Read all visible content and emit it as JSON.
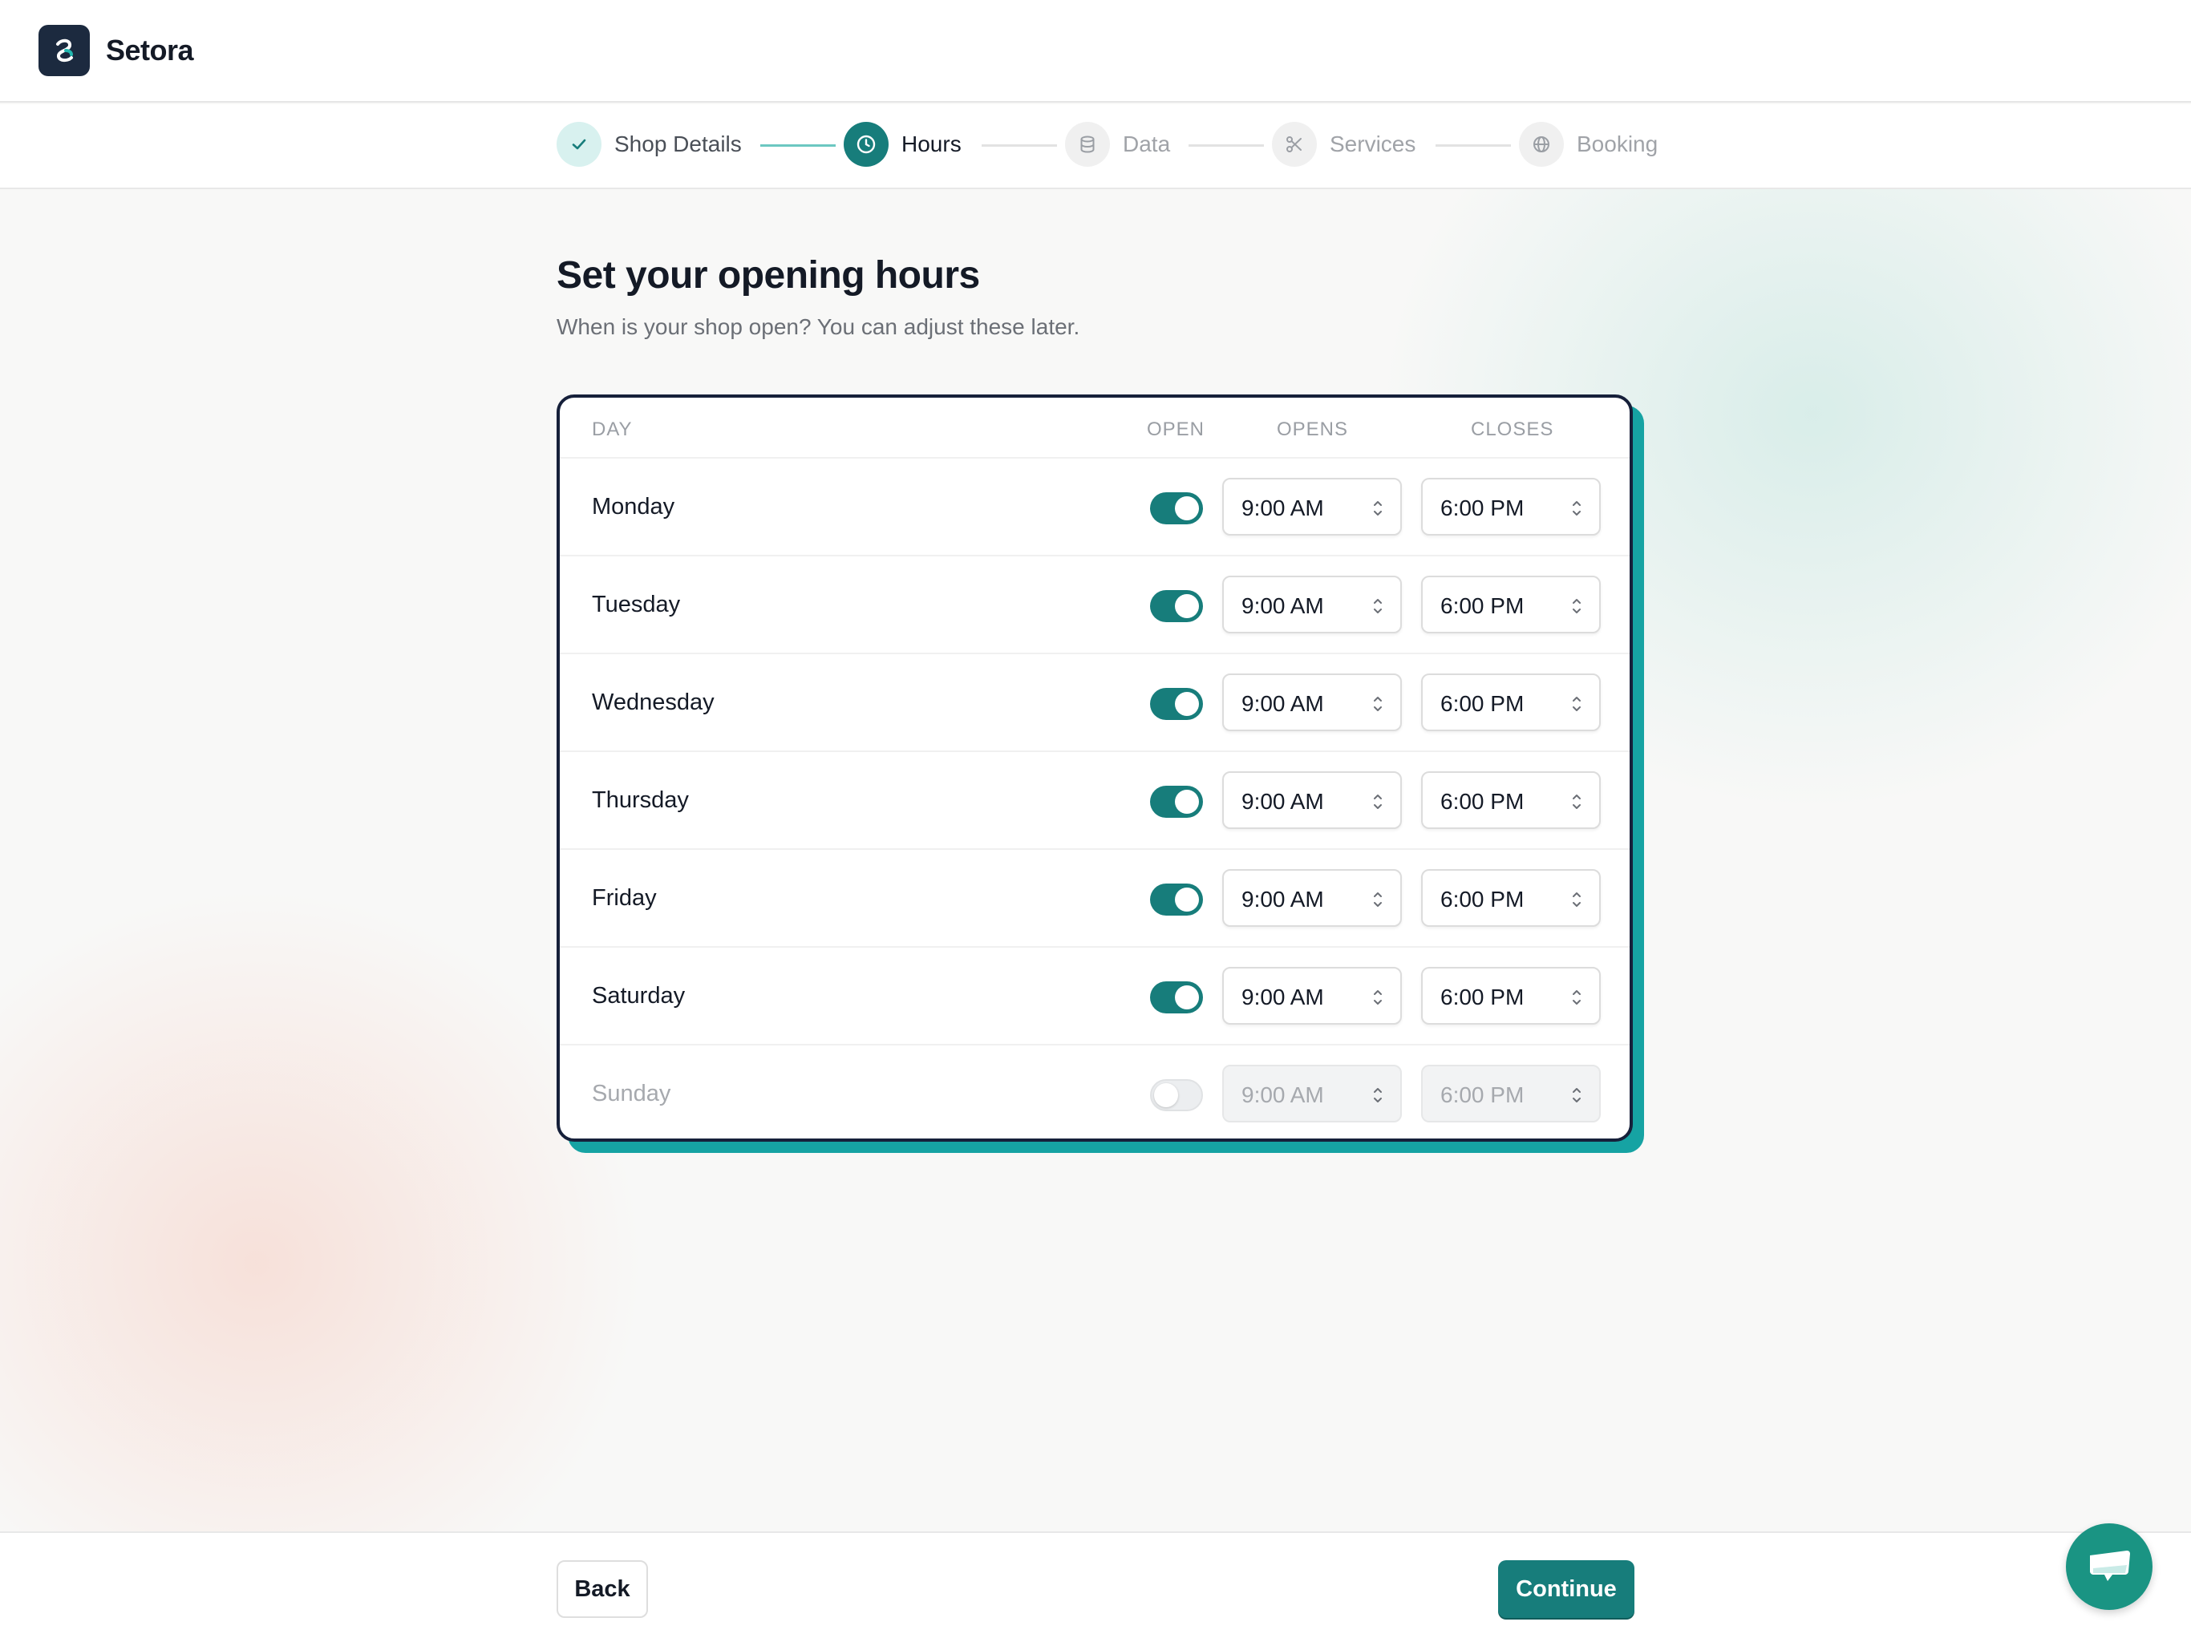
{
  "app": {
    "name": "Setora"
  },
  "stepper": {
    "steps": [
      {
        "label": "Shop Details",
        "state": "done",
        "icon": "check-icon"
      },
      {
        "label": "Hours",
        "state": "active",
        "icon": "clock-icon"
      },
      {
        "label": "Data",
        "state": "pending",
        "icon": "database-icon"
      },
      {
        "label": "Services",
        "state": "pending",
        "icon": "scissors-icon"
      },
      {
        "label": "Booking",
        "state": "pending",
        "icon": "globe-icon"
      }
    ]
  },
  "page": {
    "title": "Set your opening hours",
    "subtitle": "When is your shop open? You can adjust these later."
  },
  "table": {
    "headers": {
      "day": "DAY",
      "open": "OPEN",
      "opens": "OPENS",
      "closes": "CLOSES"
    },
    "rows": [
      {
        "day": "Monday",
        "open": true,
        "opens": "9:00 AM",
        "closes": "6:00 PM"
      },
      {
        "day": "Tuesday",
        "open": true,
        "opens": "9:00 AM",
        "closes": "6:00 PM"
      },
      {
        "day": "Wednesday",
        "open": true,
        "opens": "9:00 AM",
        "closes": "6:00 PM"
      },
      {
        "day": "Thursday",
        "open": true,
        "opens": "9:00 AM",
        "closes": "6:00 PM"
      },
      {
        "day": "Friday",
        "open": true,
        "opens": "9:00 AM",
        "closes": "6:00 PM"
      },
      {
        "day": "Saturday",
        "open": true,
        "opens": "9:00 AM",
        "closes": "6:00 PM"
      },
      {
        "day": "Sunday",
        "open": false,
        "opens": "9:00 AM",
        "closes": "6:00 PM"
      }
    ]
  },
  "footer": {
    "back_label": "Back",
    "continue_label": "Continue"
  },
  "colors": {
    "accent": "#177d7b",
    "brand_dark": "#1c2a3f",
    "card_shadow": "#16a3a3",
    "chat_fab": "#1a9483"
  },
  "chat": {
    "icon": "chat-bubble-icon"
  }
}
